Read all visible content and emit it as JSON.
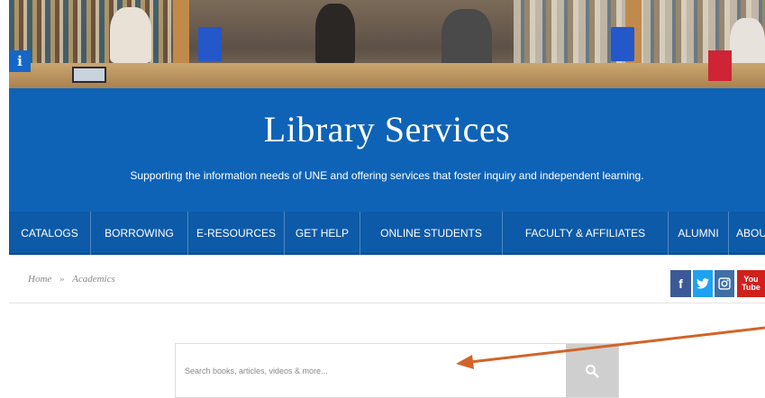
{
  "hero": {
    "info_badge": "i"
  },
  "banner": {
    "title": "Library Services",
    "tagline": "Supporting the information needs of UNE and offering services that foster inquiry and independent learning."
  },
  "nav": {
    "items": [
      {
        "label": "CATALOGS"
      },
      {
        "label": "BORROWING"
      },
      {
        "label": "E-RESOURCES"
      },
      {
        "label": "GET HELP"
      },
      {
        "label": "ONLINE STUDENTS"
      },
      {
        "label": "FACULTY & AFFILIATES"
      },
      {
        "label": "ALUMNI"
      },
      {
        "label": "ABOU"
      }
    ]
  },
  "breadcrumb": {
    "home": "Home",
    "separator": "»",
    "current": "Academics"
  },
  "social": {
    "facebook": "f",
    "youtube_top": "You",
    "youtube_bottom": "Tube",
    "icons": [
      "facebook-icon",
      "twitter-icon",
      "instagram-icon",
      "youtube-icon"
    ]
  },
  "search": {
    "placeholder": "Search books, articles, videos & more...",
    "value": "",
    "button_icon": "search-icon"
  },
  "colors": {
    "banner": "#0e63b7",
    "nav": "#0d5aa8",
    "arrow": "#d2632a",
    "search_button": "#cfcfcf"
  }
}
